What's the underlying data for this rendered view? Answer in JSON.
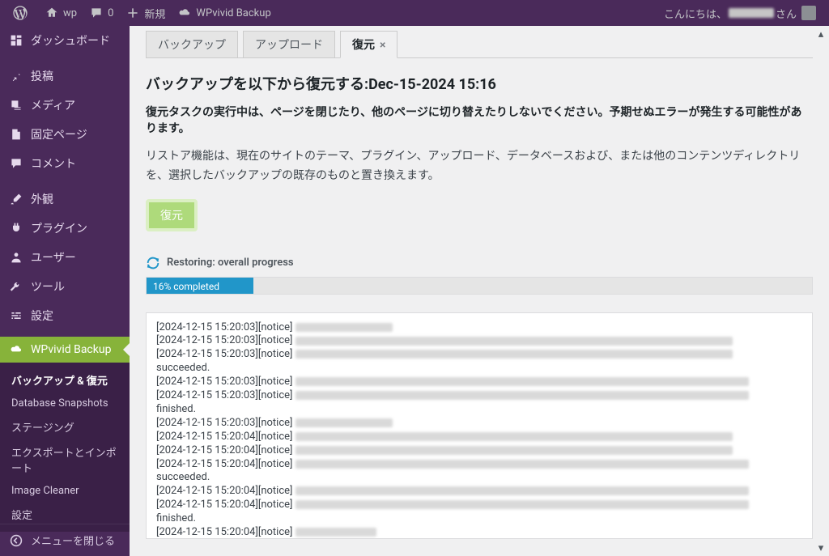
{
  "adminbar": {
    "site_name": "wp",
    "comments_count": "0",
    "new_label": "新規",
    "plugin_name": "WPvivid Backup",
    "greeting_prefix": "こんにちは、",
    "greeting_suffix": " さん",
    "username_redacted_width": 56
  },
  "sidebar": {
    "items": [
      {
        "key": "dashboard",
        "label": "ダッシュボード",
        "icon": "dashboard"
      },
      {
        "sep": true
      },
      {
        "key": "posts",
        "label": "投稿",
        "icon": "pin"
      },
      {
        "key": "media",
        "label": "メディア",
        "icon": "media"
      },
      {
        "key": "pages",
        "label": "固定ページ",
        "icon": "page"
      },
      {
        "key": "comments",
        "label": "コメント",
        "icon": "comment"
      },
      {
        "sep": true
      },
      {
        "key": "appearance",
        "label": "外観",
        "icon": "brush"
      },
      {
        "key": "plugins",
        "label": "プラグイン",
        "icon": "plug"
      },
      {
        "key": "users",
        "label": "ユーザー",
        "icon": "user"
      },
      {
        "key": "tools",
        "label": "ツール",
        "icon": "wrench"
      },
      {
        "key": "settings",
        "label": "設定",
        "icon": "sliders"
      },
      {
        "sep": true
      },
      {
        "key": "wpvivid",
        "label": "WPvivid Backup",
        "icon": "cloud",
        "current": true
      }
    ],
    "submenu": [
      {
        "key": "backup-restore",
        "label": "バックアップ & 復元",
        "current": true
      },
      {
        "key": "db-snapshots",
        "label": "Database Snapshots"
      },
      {
        "key": "staging",
        "label": "ステージング"
      },
      {
        "key": "export-import",
        "label": "エクスポートとインポート"
      },
      {
        "key": "image-cleaner",
        "label": "Image Cleaner"
      },
      {
        "key": "settings",
        "label": "設定"
      }
    ],
    "collapse_label": "メニューを閉じる"
  },
  "tabs": [
    {
      "key": "backup",
      "label": "バックアップ"
    },
    {
      "key": "upload",
      "label": "アップロード"
    },
    {
      "key": "restore",
      "label": "復元",
      "active": true,
      "closable": true
    }
  ],
  "content": {
    "heading_prefix": "バックアップを以下から復元する:",
    "heading_date": "Dec-15-2024 15:16",
    "warning": "復元タスクの実行中は、ページを閉じたり、他のページに切り替えたりしないでください。予期せぬエラーが発生する可能性があります。",
    "description": "リストア機能は、現在のサイトのテーマ、プラグイン、アップロード、データベースおよび、または他のコンテンツディレクトリを、選択したバックアップの既存のものと置き換えます。",
    "restore_button": "復元",
    "progress_title": "Restoring: overall progress",
    "progress_percent": 16,
    "progress_text": "16% completed",
    "log": [
      {
        "ts": "[2024-12-15 15:20:03][notice]",
        "blur": 120
      },
      {
        "ts": "[2024-12-15 15:20:03][notice]",
        "blur": 540
      },
      {
        "ts": "[2024-12-15 15:20:03][notice]",
        "blur": 540,
        "tail": " succeeded."
      },
      {
        "tail_only": "succeeded."
      },
      {
        "ts": "[2024-12-15 15:20:03][notice]",
        "blur": 560
      },
      {
        "ts": "[2024-12-15 15:20:03][notice]",
        "blur": 560,
        "tail": " finished."
      },
      {
        "tail_only": "finished."
      },
      {
        "ts": "[2024-12-15 15:20:03][notice]",
        "blur": 120
      },
      {
        "ts": "[2024-12-15 15:20:04][notice]",
        "blur": 540
      },
      {
        "ts": "[2024-12-15 15:20:04][notice]",
        "blur": 540
      },
      {
        "ts": "[2024-12-15 15:20:04][notice]",
        "blur": 560,
        "tail": " succeeded."
      },
      {
        "tail_only": "succeeded."
      },
      {
        "ts": "[2024-12-15 15:20:04][notice]",
        "blur": 560
      },
      {
        "ts": "[2024-12-15 15:20:04][notice]",
        "blur": 560,
        "tail": " finished."
      },
      {
        "tail_only": "finished."
      },
      {
        "ts": "[2024-12-15 15:20:04][notice]",
        "blur": 100
      }
    ]
  }
}
